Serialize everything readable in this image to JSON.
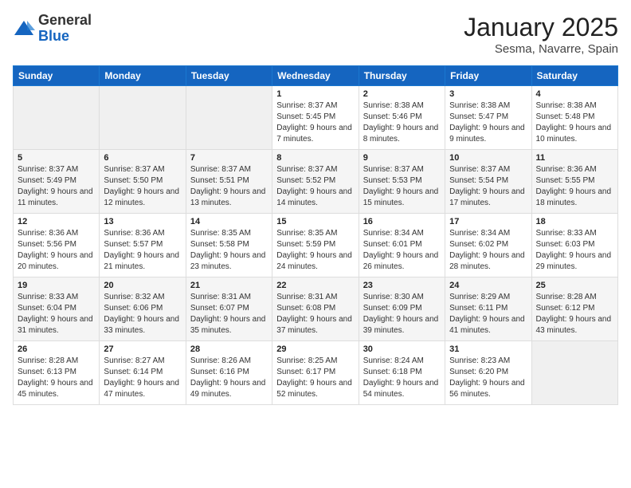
{
  "header": {
    "logo_general": "General",
    "logo_blue": "Blue",
    "month": "January 2025",
    "location": "Sesma, Navarre, Spain"
  },
  "weekdays": [
    "Sunday",
    "Monday",
    "Tuesday",
    "Wednesday",
    "Thursday",
    "Friday",
    "Saturday"
  ],
  "weeks": [
    [
      {
        "day": "",
        "info": ""
      },
      {
        "day": "",
        "info": ""
      },
      {
        "day": "",
        "info": ""
      },
      {
        "day": "1",
        "info": "Sunrise: 8:37 AM\nSunset: 5:45 PM\nDaylight: 9 hours\nand 7 minutes."
      },
      {
        "day": "2",
        "info": "Sunrise: 8:38 AM\nSunset: 5:46 PM\nDaylight: 9 hours\nand 8 minutes."
      },
      {
        "day": "3",
        "info": "Sunrise: 8:38 AM\nSunset: 5:47 PM\nDaylight: 9 hours\nand 9 minutes."
      },
      {
        "day": "4",
        "info": "Sunrise: 8:38 AM\nSunset: 5:48 PM\nDaylight: 9 hours\nand 10 minutes."
      }
    ],
    [
      {
        "day": "5",
        "info": "Sunrise: 8:37 AM\nSunset: 5:49 PM\nDaylight: 9 hours\nand 11 minutes."
      },
      {
        "day": "6",
        "info": "Sunrise: 8:37 AM\nSunset: 5:50 PM\nDaylight: 9 hours\nand 12 minutes."
      },
      {
        "day": "7",
        "info": "Sunrise: 8:37 AM\nSunset: 5:51 PM\nDaylight: 9 hours\nand 13 minutes."
      },
      {
        "day": "8",
        "info": "Sunrise: 8:37 AM\nSunset: 5:52 PM\nDaylight: 9 hours\nand 14 minutes."
      },
      {
        "day": "9",
        "info": "Sunrise: 8:37 AM\nSunset: 5:53 PM\nDaylight: 9 hours\nand 15 minutes."
      },
      {
        "day": "10",
        "info": "Sunrise: 8:37 AM\nSunset: 5:54 PM\nDaylight: 9 hours\nand 17 minutes."
      },
      {
        "day": "11",
        "info": "Sunrise: 8:36 AM\nSunset: 5:55 PM\nDaylight: 9 hours\nand 18 minutes."
      }
    ],
    [
      {
        "day": "12",
        "info": "Sunrise: 8:36 AM\nSunset: 5:56 PM\nDaylight: 9 hours\nand 20 minutes."
      },
      {
        "day": "13",
        "info": "Sunrise: 8:36 AM\nSunset: 5:57 PM\nDaylight: 9 hours\nand 21 minutes."
      },
      {
        "day": "14",
        "info": "Sunrise: 8:35 AM\nSunset: 5:58 PM\nDaylight: 9 hours\nand 23 minutes."
      },
      {
        "day": "15",
        "info": "Sunrise: 8:35 AM\nSunset: 5:59 PM\nDaylight: 9 hours\nand 24 minutes."
      },
      {
        "day": "16",
        "info": "Sunrise: 8:34 AM\nSunset: 6:01 PM\nDaylight: 9 hours\nand 26 minutes."
      },
      {
        "day": "17",
        "info": "Sunrise: 8:34 AM\nSunset: 6:02 PM\nDaylight: 9 hours\nand 28 minutes."
      },
      {
        "day": "18",
        "info": "Sunrise: 8:33 AM\nSunset: 6:03 PM\nDaylight: 9 hours\nand 29 minutes."
      }
    ],
    [
      {
        "day": "19",
        "info": "Sunrise: 8:33 AM\nSunset: 6:04 PM\nDaylight: 9 hours\nand 31 minutes."
      },
      {
        "day": "20",
        "info": "Sunrise: 8:32 AM\nSunset: 6:06 PM\nDaylight: 9 hours\nand 33 minutes."
      },
      {
        "day": "21",
        "info": "Sunrise: 8:31 AM\nSunset: 6:07 PM\nDaylight: 9 hours\nand 35 minutes."
      },
      {
        "day": "22",
        "info": "Sunrise: 8:31 AM\nSunset: 6:08 PM\nDaylight: 9 hours\nand 37 minutes."
      },
      {
        "day": "23",
        "info": "Sunrise: 8:30 AM\nSunset: 6:09 PM\nDaylight: 9 hours\nand 39 minutes."
      },
      {
        "day": "24",
        "info": "Sunrise: 8:29 AM\nSunset: 6:11 PM\nDaylight: 9 hours\nand 41 minutes."
      },
      {
        "day": "25",
        "info": "Sunrise: 8:28 AM\nSunset: 6:12 PM\nDaylight: 9 hours\nand 43 minutes."
      }
    ],
    [
      {
        "day": "26",
        "info": "Sunrise: 8:28 AM\nSunset: 6:13 PM\nDaylight: 9 hours\nand 45 minutes."
      },
      {
        "day": "27",
        "info": "Sunrise: 8:27 AM\nSunset: 6:14 PM\nDaylight: 9 hours\nand 47 minutes."
      },
      {
        "day": "28",
        "info": "Sunrise: 8:26 AM\nSunset: 6:16 PM\nDaylight: 9 hours\nand 49 minutes."
      },
      {
        "day": "29",
        "info": "Sunrise: 8:25 AM\nSunset: 6:17 PM\nDaylight: 9 hours\nand 52 minutes."
      },
      {
        "day": "30",
        "info": "Sunrise: 8:24 AM\nSunset: 6:18 PM\nDaylight: 9 hours\nand 54 minutes."
      },
      {
        "day": "31",
        "info": "Sunrise: 8:23 AM\nSunset: 6:20 PM\nDaylight: 9 hours\nand 56 minutes."
      },
      {
        "day": "",
        "info": ""
      }
    ]
  ]
}
